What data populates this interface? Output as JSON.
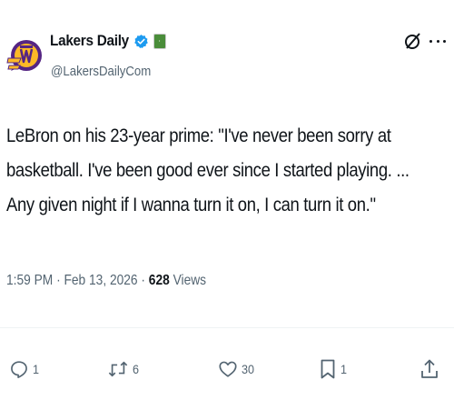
{
  "author": {
    "display_name": "Lakers Daily",
    "handle": "@LakersDailyCom",
    "verified": true,
    "avatar_icon": "lakers-daily-logo",
    "affiliate_badge_icon": "affiliate-badge-icon"
  },
  "tweet": {
    "text": "LeBron on his 23-year prime: \"I've never been sorry at basketball. I've been good ever since I started playing. ... Any given night if I wanna turn it on, I can turn it on.\""
  },
  "meta": {
    "time": "1:59 PM",
    "separator": " · ",
    "date": "Feb 13, 2026",
    "views_count": "628",
    "views_label": " Views"
  },
  "actions": {
    "replies": "1",
    "reposts": "6",
    "likes": "30",
    "bookmarks": "1"
  },
  "colors": {
    "text": "#0f1419",
    "secondary": "#536471",
    "verified_blue": "#1d9bf0",
    "lakers_purple": "#552583",
    "lakers_gold": "#fdb927"
  }
}
